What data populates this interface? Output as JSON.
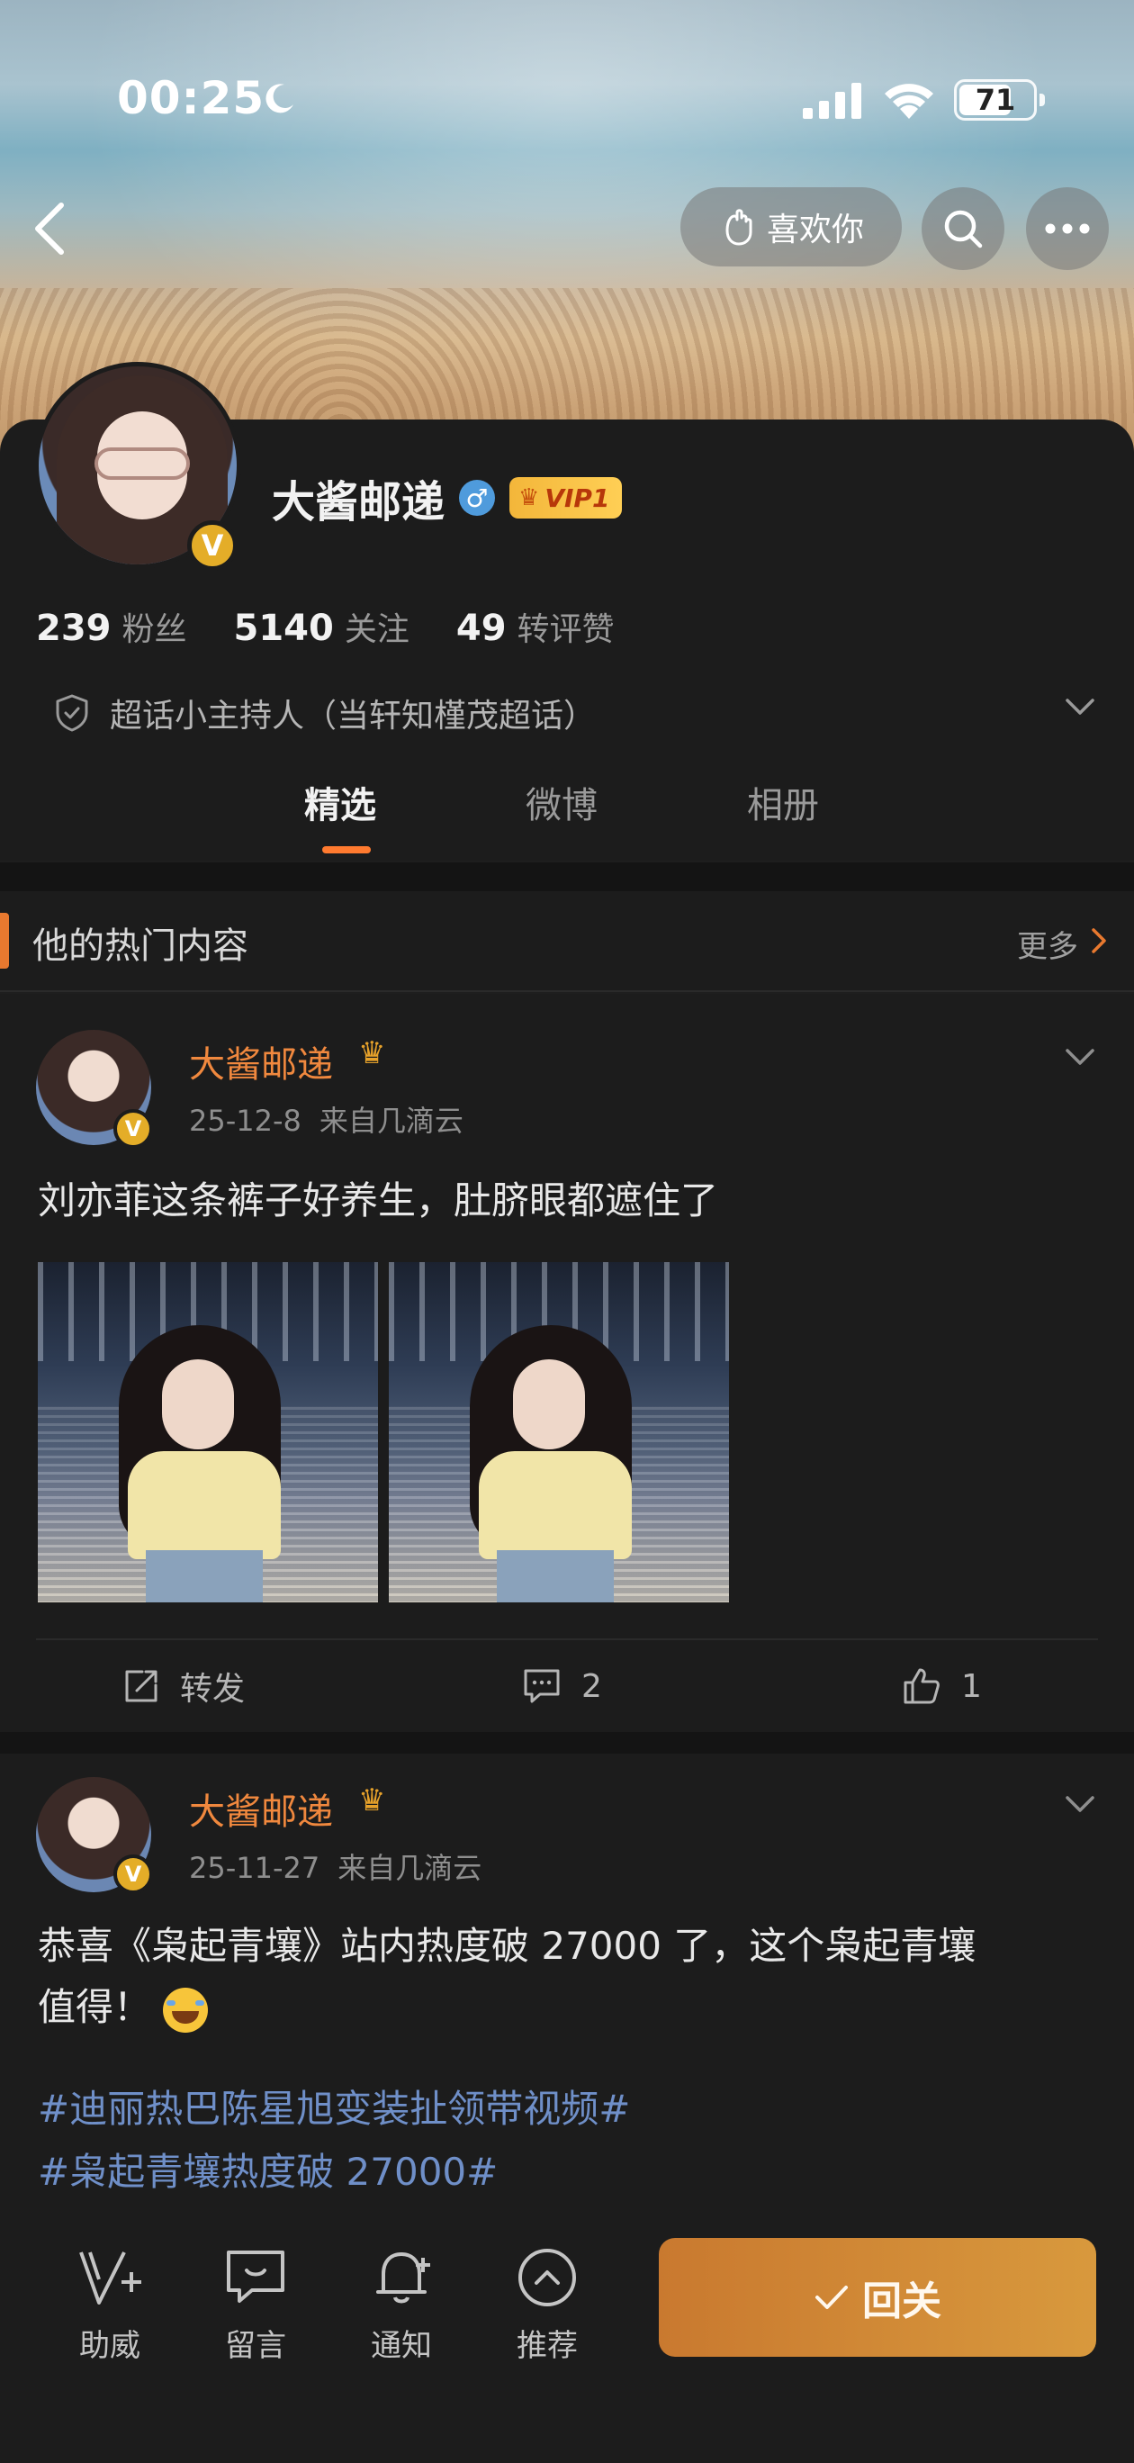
{
  "status_bar": {
    "time": "00:25",
    "battery": "71",
    "battery_level": 0.71
  },
  "header": {
    "like_button_label": "喜欢你",
    "icons": [
      "back-icon",
      "search-icon",
      "more-icon"
    ]
  },
  "profile": {
    "name": "大酱邮递",
    "vip_label": "VIP1",
    "stats": [
      {
        "num": "239",
        "label": "粉丝"
      },
      {
        "num": "5140",
        "label": "关注"
      },
      {
        "num": "49",
        "label": "转评赞"
      }
    ],
    "role": "超话小主持人（当轩知槿茂超话）",
    "tabs": [
      "精选",
      "微博",
      "相册"
    ],
    "active_tab": "精选"
  },
  "hot_section": {
    "title": "他的热门内容",
    "more": "更多"
  },
  "posts": [
    {
      "author": "大酱邮递",
      "date": "25-12-8",
      "source": "来自几滴云",
      "text": "刘亦菲这条裤子好养生，肚脐眼都遮住了",
      "actions": {
        "repost": "转发",
        "comments": "2",
        "likes": "1"
      }
    },
    {
      "author": "大酱邮递",
      "date": "25-11-27",
      "source": "来自几滴云",
      "text_line1": "恭喜《枭起青壤》站内热度破 27000 了，这个枭起青壤",
      "text_line2": "值得！",
      "tag1": "#迪丽热巴陈星旭变装扯领带视频#",
      "tag2": "#枭起青壤热度破 27000#"
    }
  ],
  "bottom_bar": {
    "items": [
      "助威",
      "留言",
      "通知",
      "推荐"
    ],
    "follow_label": "回关"
  },
  "colors": {
    "accent_orange": "#f0883e",
    "tab_underline": "#ff7a2f",
    "hashtag_blue": "#6f8fc8",
    "background": "#1c1c1c"
  }
}
